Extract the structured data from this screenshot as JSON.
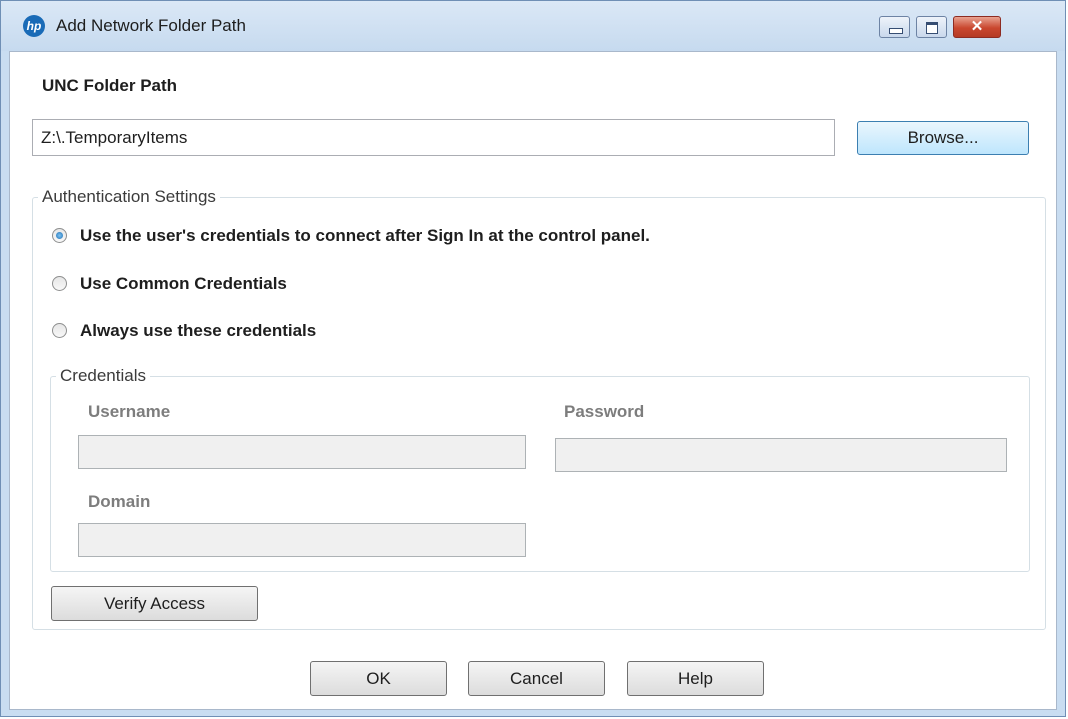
{
  "window": {
    "title": "Add Network Folder Path",
    "logo_text": "hp"
  },
  "unc": {
    "label": "UNC Folder Path",
    "value": "Z:\\.TemporaryItems",
    "browse_label": "Browse..."
  },
  "auth": {
    "legend": "Authentication Settings",
    "options": [
      {
        "label": "Use the user's credentials to connect after Sign In at the control panel.",
        "checked": true
      },
      {
        "label": "Use Common Credentials",
        "checked": false
      },
      {
        "label": "Always use these credentials",
        "checked": false
      }
    ],
    "credentials": {
      "legend": "Credentials",
      "username_label": "Username",
      "username_value": "",
      "password_label": "Password",
      "password_value": "",
      "domain_label": "Domain",
      "domain_value": ""
    },
    "verify_label": "Verify Access"
  },
  "footer": {
    "ok_label": "OK",
    "cancel_label": "Cancel",
    "help_label": "Help"
  },
  "colors": {
    "accent": "#3c7fb1",
    "close_button": "#c9472f",
    "frame": "#c9ddf1"
  }
}
